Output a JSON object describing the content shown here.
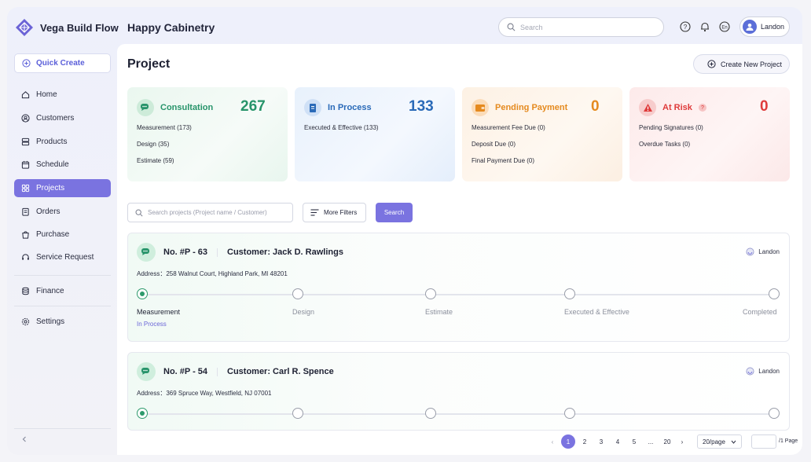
{
  "app": {
    "name": "Vega Build Flow",
    "company": "Happy Cabinetry"
  },
  "topbar": {
    "search_placeholder": "Search",
    "user": "Landon"
  },
  "sidebar": {
    "quick_create": "Quick Create",
    "items": [
      {
        "label": "Home",
        "icon": "home-icon"
      },
      {
        "label": "Customers",
        "icon": "user-icon"
      },
      {
        "label": "Products",
        "icon": "products-icon"
      },
      {
        "label": "Schedule",
        "icon": "calendar-icon"
      },
      {
        "label": "Projects",
        "icon": "projects-icon",
        "active": true
      },
      {
        "label": "Orders",
        "icon": "orders-icon"
      },
      {
        "label": "Purchase",
        "icon": "purchase-icon"
      },
      {
        "label": "Service Request",
        "icon": "headset-icon"
      },
      {
        "label": "Finance",
        "icon": "finance-icon"
      },
      {
        "label": "Settings",
        "icon": "gear-icon"
      }
    ]
  },
  "page": {
    "title": "Project",
    "create_button": "Create New Project"
  },
  "stats": [
    {
      "label": "Consultation",
      "count": "267",
      "color": "#27946a",
      "rows": [
        "Measurement (173)",
        "Design (35)",
        "Estimate (59)"
      ]
    },
    {
      "label": "In Process",
      "count": "133",
      "color": "#2a6ab8",
      "rows": [
        "Executed & Effective (133)"
      ]
    },
    {
      "label": "Pending Payment",
      "count": "0",
      "color": "#e58a1f",
      "rows": [
        "Measurement Fee Due (0)",
        "Deposit Due (0)",
        "Final Payment Due (0)"
      ]
    },
    {
      "label": "At Risk",
      "count": "0",
      "color": "#df3b3b",
      "help": "?",
      "rows": [
        "Pending Signatures (0)",
        "Overdue Tasks (0)"
      ]
    }
  ],
  "filters": {
    "search_placeholder": "Search projects (Project name / Customer)",
    "more_filters": "More Filters",
    "search_button": "Search"
  },
  "steps": [
    "Measurement",
    "Design",
    "Estimate",
    "Executed & Effective",
    "Completed"
  ],
  "projects": [
    {
      "number": "No. #P - 63",
      "customer": "Customer: Jack D. Rawlings",
      "owner": "Landon",
      "address": "Address：258 Walnut Court, Highland Park, MI 48201",
      "status": "In Process"
    },
    {
      "number": "No. #P - 54",
      "customer": "Customer: Carl R. Spence",
      "owner": "Landon",
      "address": "Address：369 Spruce Way, Westfield, NJ 07001"
    }
  ],
  "pagination": {
    "prev": "‹",
    "next": "›",
    "pages": [
      "1",
      "2",
      "3",
      "4",
      "5",
      "...",
      "20"
    ],
    "current": "1",
    "per_page": "20/page",
    "page_label": "/1 Page"
  }
}
